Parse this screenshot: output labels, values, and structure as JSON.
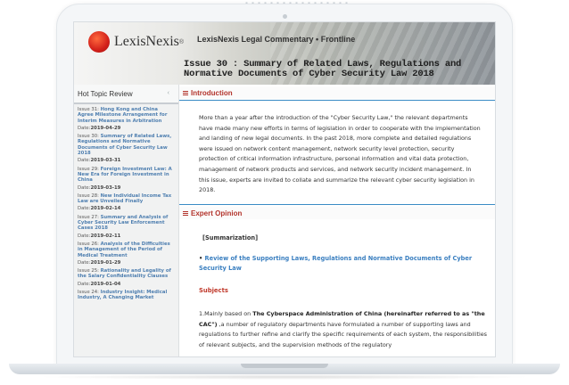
{
  "header": {
    "brand": "LexisNexis",
    "brand_tm": "®",
    "product": "LexisNexis Legal Commentary • Frontline",
    "issue_title": "Issue 30 : Summary of Related Laws, Regulations and Normative Documents of Cyber Security Law 2018"
  },
  "sidebar": {
    "title": "Hot Topic Review",
    "arrow": "‹",
    "items": [
      {
        "prefix": "Issue 31: ",
        "title": "Hong Kong and China Agree Milestone Arrangement for Interim Measures in Arbitration",
        "date_label": "Date:",
        "date": "2019-04-29"
      },
      {
        "prefix": "Issue 30: ",
        "title": "Summary of Related Laws, Regulations and Normative Documents of Cyber Security Law 2018",
        "date_label": "Date:",
        "date": "2019-03-31"
      },
      {
        "prefix": "Issue 29: ",
        "title": "Foreign Investment Law: A New Era for Foreign Investment in China",
        "date_label": "Date:",
        "date": "2019-03-19"
      },
      {
        "prefix": "Issue 28: ",
        "title": "New Individual Income Tax Law are Unveiled Finally",
        "date_label": "Date:",
        "date": "2019-02-14"
      },
      {
        "prefix": "Issue 27: ",
        "title": "Summary and Analysis of Cyber Security Law Enforcement Cases 2018",
        "date_label": "Date:",
        "date": "2019-02-11"
      },
      {
        "prefix": "Issue 26: ",
        "title": "Analysis of the Difficulties in Management of the Period of Medical Treatment",
        "date_label": "Date:",
        "date": "2019-01-29"
      },
      {
        "prefix": "Issue 25: ",
        "title": "Rationality and Legality of the Salary Confidentiality Clauses",
        "date_label": "Date:",
        "date": "2019-01-04"
      },
      {
        "prefix": "Issue 24: ",
        "title": "Industry Insight: Medical Industry, A Changing Market",
        "date_label": "",
        "date": ""
      }
    ]
  },
  "main": {
    "intro_heading": "Introduction",
    "intro_text": "More than a year after the introduction of the \"Cyber Security Law,\" the relevant departments have made many new efforts in terms of legislation in order to cooperate with the implementation and landing of new legal documents. In the past 2018, more complete and detailed regulations were issued on network content management, network security level protection, security protection of critical information infrastructure, personal information and vital data protection, management of network products and services, and network security incident management. In this issue, experts are invited to collate and summarize the relevant cyber security legislation in 2018.",
    "opinion_heading": "Expert Opinion",
    "summarization": "[Summarization]",
    "review_bullet": "•",
    "review_link": "Review of the Supporting Laws, Regulations and Normative Documents of Cyber Security Law",
    "subjects_heading": "Subjects",
    "body_prefix": "1.Mainly based on ",
    "body_bold": "The Cyberspace Administration of China (hereinafter referred to as \"the CAC\")",
    "body_rest": " ,a number of regulatory departments have formulated a number of supporting laws and regulations to further refine and clarify the specific requirements of each system, the responsibilities of relevant subjects, and the supervision methods of the regulatory"
  },
  "colors": {
    "accent_red": "#b3342c",
    "link_blue": "#3a7fc0",
    "divider_blue": "#3a8cc5"
  }
}
